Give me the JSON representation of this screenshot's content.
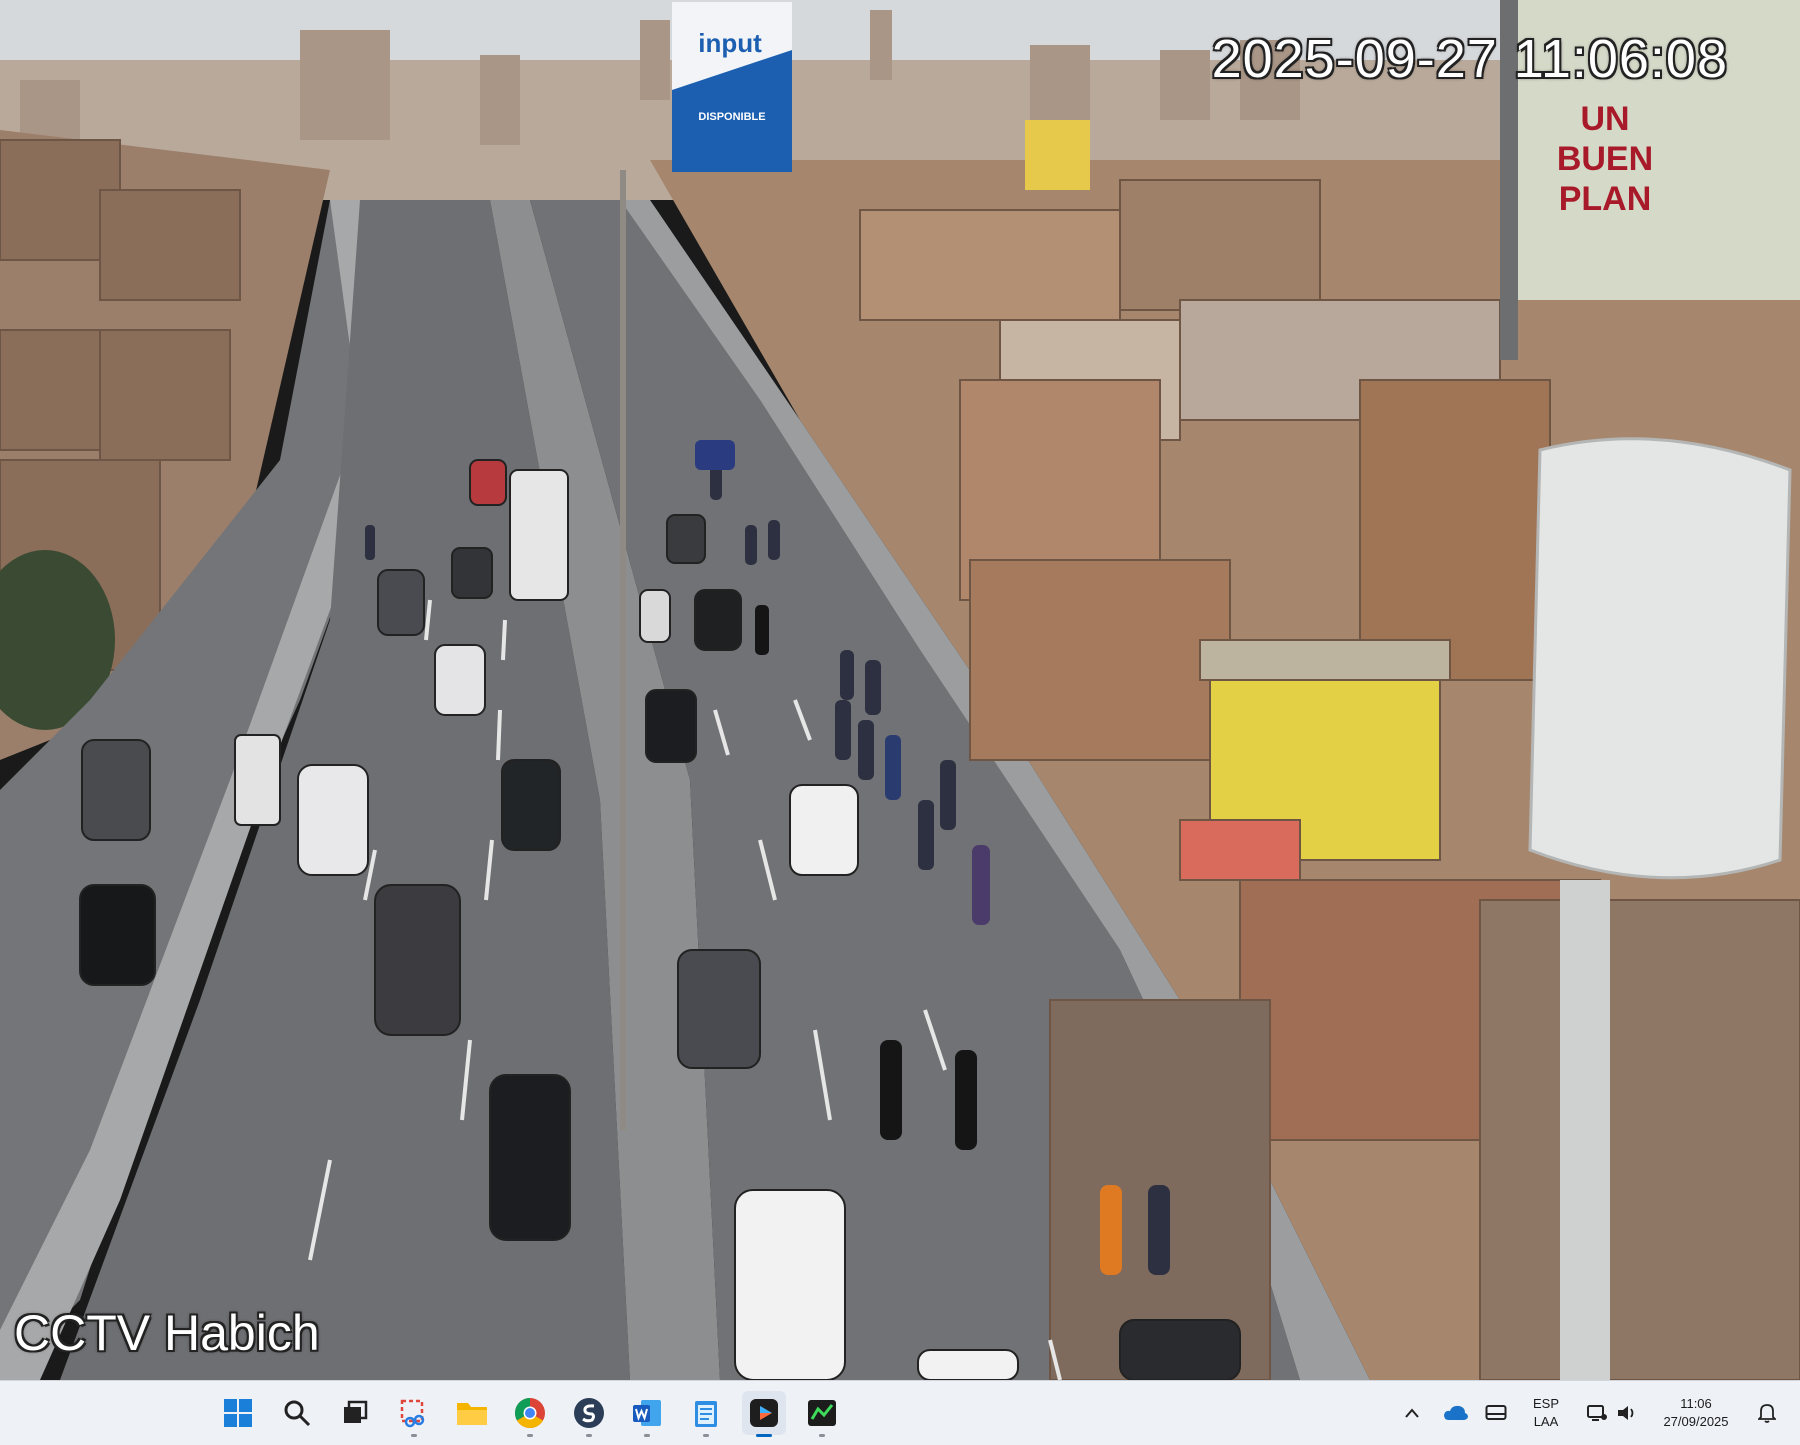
{
  "camera": {
    "timestamp": "2025-09-27 11:06:08",
    "name": "CCTV Habich"
  },
  "scene": {
    "billboard_top_brand": "input",
    "billboard_top_sub": "DISPONIBLE",
    "billboard_right_line1": "UN",
    "billboard_right_line2": "BUEN",
    "billboard_right_line3": "PLAN"
  },
  "taskbar": {
    "icons": [
      {
        "name": "windows-start",
        "label": "Start"
      },
      {
        "name": "search",
        "label": "Search"
      },
      {
        "name": "task-view",
        "label": "Task View"
      },
      {
        "name": "snipping-tool",
        "label": "Snipping Tool"
      },
      {
        "name": "file-explorer",
        "label": "File Explorer"
      },
      {
        "name": "chrome",
        "label": "Google Chrome"
      },
      {
        "name": "app-s",
        "label": "App"
      },
      {
        "name": "word",
        "label": "Word"
      },
      {
        "name": "notepad",
        "label": "Notepad"
      },
      {
        "name": "media-player",
        "label": "Media Player"
      },
      {
        "name": "terminal-app",
        "label": "App"
      }
    ],
    "tray": {
      "language_line1": "ESP",
      "language_line2": "LAA",
      "time": "11:06",
      "date": "27/09/2025"
    }
  },
  "colors": {
    "taskbar_bg": "#eef2f7",
    "accent": "#0067c0",
    "road": "#6e6f72",
    "sky": "#d9dcdf"
  }
}
